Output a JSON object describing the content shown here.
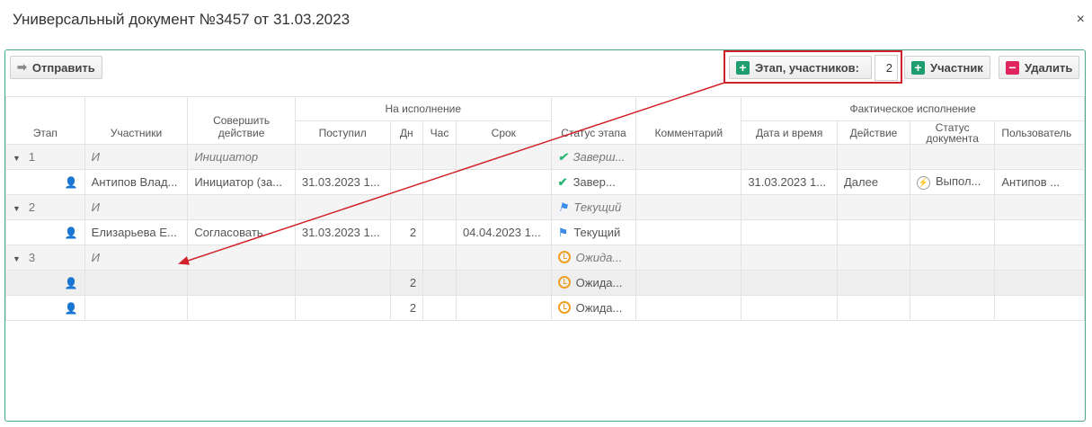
{
  "window": {
    "title": "Универсальный документ №3457 от 31.03.2023",
    "close_label": "×"
  },
  "toolbar": {
    "send_label": "Отправить",
    "stage_participants_label": "Этап, участников:",
    "stage_participants_count": "2",
    "participant_label": "Участник",
    "delete_label": "Удалить"
  },
  "table": {
    "headers": {
      "stage": "Этап",
      "participants": "Участники",
      "action": "Совершить действие",
      "exec_group": "На исполнение",
      "received": "Поступил",
      "days": "Дн",
      "hours": "Час",
      "deadline": "Срок",
      "stage_status": "Статус этапа",
      "comment": "Комментарий",
      "fact_group": "Фактическое исполнение",
      "datetime": "Дата и время",
      "fact_action": "Действие",
      "doc_status": "Статус документа",
      "user": "Пользователь"
    },
    "rows": [
      {
        "type": "stage",
        "stage": "1",
        "participant": "И",
        "action": "Инициатор",
        "status": "Заверш...",
        "status_icon": "check-icon"
      },
      {
        "type": "participant",
        "participant": "Антипов Влад...",
        "action": "Инициатор (за...",
        "received": "31.03.2023 1...",
        "days": "",
        "hours": "",
        "deadline": "",
        "status": "Завер...",
        "status_icon": "check-icon",
        "comment": "",
        "datetime": "31.03.2023 1...",
        "fact_action": "Далее",
        "doc_status": "Выпол...",
        "user": "Антипов ..."
      },
      {
        "type": "stage",
        "stage": "2",
        "participant": "И",
        "action": "",
        "status": "Текущий",
        "status_icon": "flag-icon"
      },
      {
        "type": "participant",
        "participant": "Елизарьева Е...",
        "action": "Согласовать",
        "received": "31.03.2023 1...",
        "days": "2",
        "hours": "",
        "deadline": "04.04.2023 1...",
        "status": "Текущий",
        "status_icon": "flag-icon",
        "comment": "",
        "datetime": "",
        "fact_action": "",
        "doc_status": "",
        "user": ""
      },
      {
        "type": "stage",
        "stage": "3",
        "participant": "И",
        "action": "",
        "status": "Ожида...",
        "status_icon": "clock-icon"
      },
      {
        "type": "participant",
        "participant": "",
        "action": "",
        "received": "",
        "days": "2",
        "hours": "",
        "deadline": "",
        "status": "Ожида...",
        "status_icon": "clock-icon",
        "comment": "",
        "datetime": "",
        "fact_action": "",
        "doc_status": "",
        "user": ""
      },
      {
        "type": "participant",
        "participant": "",
        "action": "",
        "received": "",
        "days": "2",
        "hours": "",
        "deadline": "",
        "status": "Ожида...",
        "status_icon": "clock-icon",
        "comment": "",
        "datetime": "",
        "fact_action": "",
        "doc_status": "",
        "user": ""
      }
    ]
  },
  "colors": {
    "panel_border": "#4aa88a",
    "accent_green": "#1e9e6e",
    "delete_red": "#e0245e",
    "annotation_red": "#d1212a",
    "check_green": "#2bb673",
    "flag_blue": "#3d8de8",
    "clock_orange": "#f0a020"
  }
}
